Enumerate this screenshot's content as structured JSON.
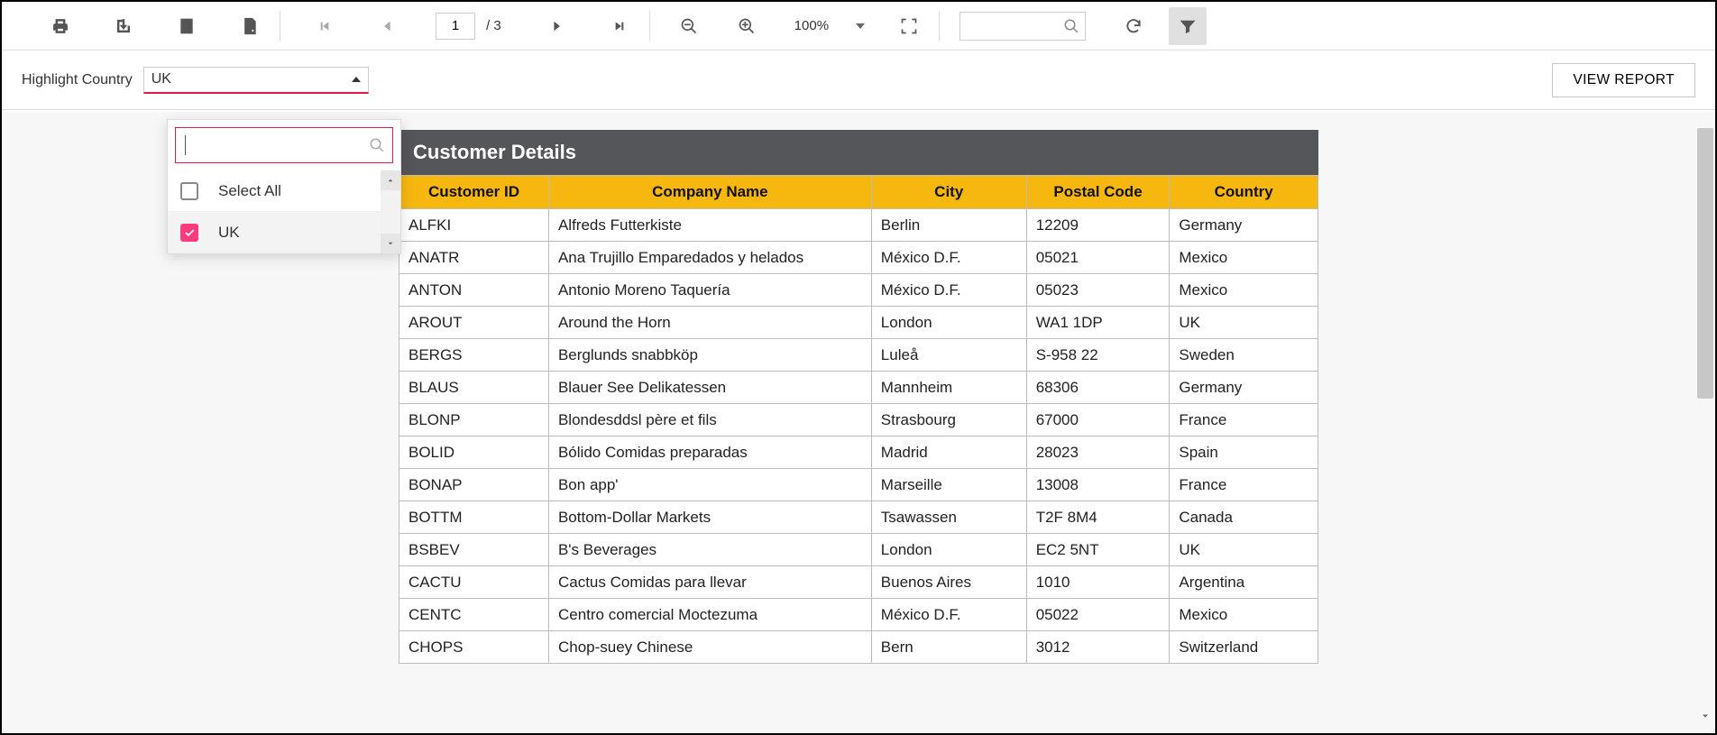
{
  "toolbar": {
    "page_current": "1",
    "page_total": "/ 3",
    "zoom_level": "100%",
    "search_value": ""
  },
  "parameters": {
    "label": "Highlight Country",
    "selected": "UK",
    "dropdown": {
      "search_value": "",
      "select_all_label": "Select All",
      "options": [
        {
          "label": "UK",
          "checked": true
        }
      ]
    },
    "view_report_label": "VIEW REPORT"
  },
  "report": {
    "title": "Customer Details",
    "columns": [
      "Customer ID",
      "Company Name",
      "City",
      "Postal Code",
      "Country"
    ],
    "rows": [
      {
        "id": "ALFKI",
        "company": "Alfreds Futterkiste",
        "city": "Berlin",
        "postal": "12209",
        "country": "Germany"
      },
      {
        "id": "ANATR",
        "company": "Ana Trujillo Emparedados y helados",
        "city": "México D.F.",
        "postal": "05021",
        "country": "Mexico"
      },
      {
        "id": "ANTON",
        "company": "Antonio Moreno Taquería",
        "city": "México D.F.",
        "postal": "05023",
        "country": "Mexico"
      },
      {
        "id": "AROUT",
        "company": "Around the Horn",
        "city": "London",
        "postal": "WA1 1DP",
        "country": "UK"
      },
      {
        "id": "BERGS",
        "company": "Berglunds snabbköp",
        "city": "Luleå",
        "postal": "S-958 22",
        "country": "Sweden"
      },
      {
        "id": "BLAUS",
        "company": "Blauer See Delikatessen",
        "city": "Mannheim",
        "postal": "68306",
        "country": "Germany"
      },
      {
        "id": "BLONP",
        "company": "Blondesddsl père et fils",
        "city": "Strasbourg",
        "postal": "67000",
        "country": "France"
      },
      {
        "id": "BOLID",
        "company": "Bólido Comidas preparadas",
        "city": "Madrid",
        "postal": "28023",
        "country": "Spain"
      },
      {
        "id": "BONAP",
        "company": "Bon app'",
        "city": "Marseille",
        "postal": "13008",
        "country": "France"
      },
      {
        "id": "BOTTM",
        "company": "Bottom-Dollar Markets",
        "city": "Tsawassen",
        "postal": "T2F 8M4",
        "country": "Canada"
      },
      {
        "id": "BSBEV",
        "company": "B's Beverages",
        "city": "London",
        "postal": "EC2 5NT",
        "country": "UK"
      },
      {
        "id": "CACTU",
        "company": "Cactus Comidas para llevar",
        "city": "Buenos Aires",
        "postal": "1010",
        "country": "Argentina"
      },
      {
        "id": "CENTC",
        "company": "Centro comercial Moctezuma",
        "city": "México D.F.",
        "postal": "05022",
        "country": "Mexico"
      },
      {
        "id": "CHOPS",
        "company": "Chop-suey Chinese",
        "city": "Bern",
        "postal": "3012",
        "country": "Switzerland"
      }
    ]
  }
}
